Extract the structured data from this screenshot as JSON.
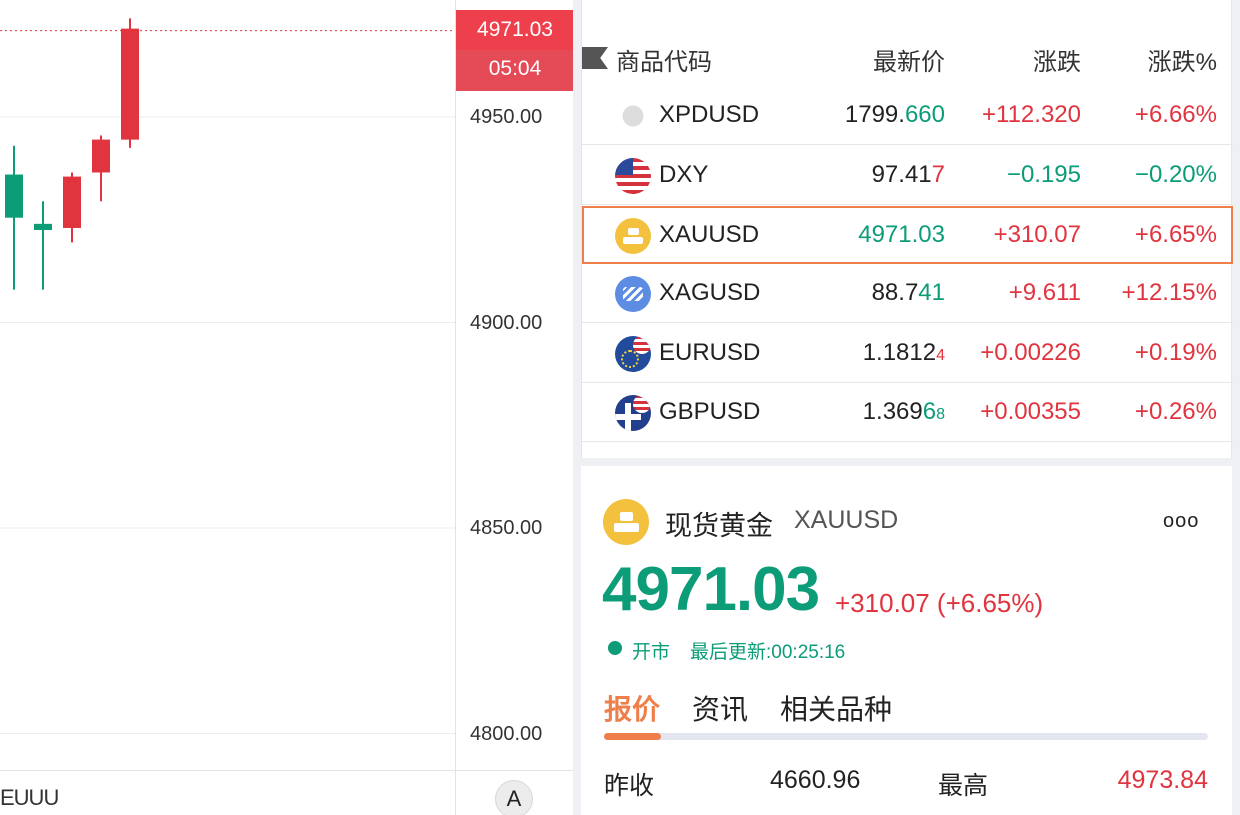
{
  "price_axis": {
    "last_price": "4971.03",
    "countdown": "05:04",
    "ticks": [
      "4950.00",
      "4900.00",
      "4850.00",
      "4800.00"
    ]
  },
  "chart_footer": {
    "x_label": "EUUU",
    "auto_button": "A"
  },
  "candles": [
    {
      "open": 4925.5,
      "high": 4943,
      "low": 4908,
      "close": 4936,
      "color": "green"
    },
    {
      "open": 4924,
      "high": 4929.5,
      "low": 4908,
      "close": 4922.5,
      "color": "green"
    },
    {
      "open": 4923,
      "high": 4936.5,
      "low": 4919.5,
      "close": 4935.5,
      "color": "red"
    },
    {
      "open": 4936.5,
      "high": 4945.5,
      "low": 4929.5,
      "close": 4944.5,
      "color": "red"
    },
    {
      "open": 4944.5,
      "high": 4974,
      "low": 4942.5,
      "close": 4971.5,
      "color": "red"
    }
  ],
  "watchlist": {
    "headers": {
      "symbol": "商品代码",
      "price": "最新价",
      "change": "涨跌",
      "change_pct": "涨跌%"
    },
    "rows": [
      {
        "icon": "palladium-icon",
        "symbol": "XPDUSD",
        "price_main": "1799.",
        "price_hl": "660",
        "price_sub": "",
        "hl_color": "green",
        "change": "+112.320",
        "change_pct": "+6.66%",
        "chg_color": "red"
      },
      {
        "icon": "us-flag-icon",
        "symbol": "DXY",
        "price_main": "97.41",
        "price_hl": "7",
        "price_sub": "",
        "hl_color": "red",
        "change": "−0.195",
        "change_pct": "−0.20%",
        "chg_color": "green"
      },
      {
        "icon": "gold-bar-icon",
        "symbol": "XAUUSD",
        "price_main": "",
        "price_hl": "4971.03",
        "price_sub": "",
        "hl_color": "green",
        "change": "+310.07",
        "change_pct": "+6.65%",
        "chg_color": "red",
        "selected": true
      },
      {
        "icon": "silver-icon",
        "symbol": "XAGUSD",
        "price_main": "88.7",
        "price_hl": "41",
        "price_sub": "",
        "hl_color": "green",
        "change": "+9.611",
        "change_pct": "+12.15%",
        "chg_color": "red"
      },
      {
        "icon": "eur-usd-flag-icon",
        "symbol": "EURUSD",
        "price_main": "1.1812",
        "price_hl": "",
        "price_sub": "4",
        "hl_color": "red",
        "change": "+0.00226",
        "change_pct": "+0.19%",
        "chg_color": "red"
      },
      {
        "icon": "gbp-usd-flag-icon",
        "symbol": "GBPUSD",
        "price_main": "1.369",
        "price_hl": "6",
        "price_sub": "8",
        "hl_color": "green",
        "change": "+0.00355",
        "change_pct": "+0.26%",
        "chg_color": "red"
      }
    ]
  },
  "detail": {
    "name": "现货黄金",
    "code": "XAUUSD",
    "price": "4971.03",
    "change": "+310.07 (+6.65%)",
    "status": "开市",
    "last_update": "最后更新:00:25:16",
    "more": "ooo",
    "tabs": [
      "报价",
      "资讯",
      "相关品种"
    ],
    "active_tab": 0,
    "quotes": {
      "prev_close_label": "昨收",
      "prev_close": "4660.96",
      "high_label": "最高",
      "high": "4973.84"
    }
  },
  "colors": {
    "up": "#e0343f",
    "down": "#0c9c78",
    "accent": "#ef7f4a",
    "gold": "#f3c13d"
  }
}
